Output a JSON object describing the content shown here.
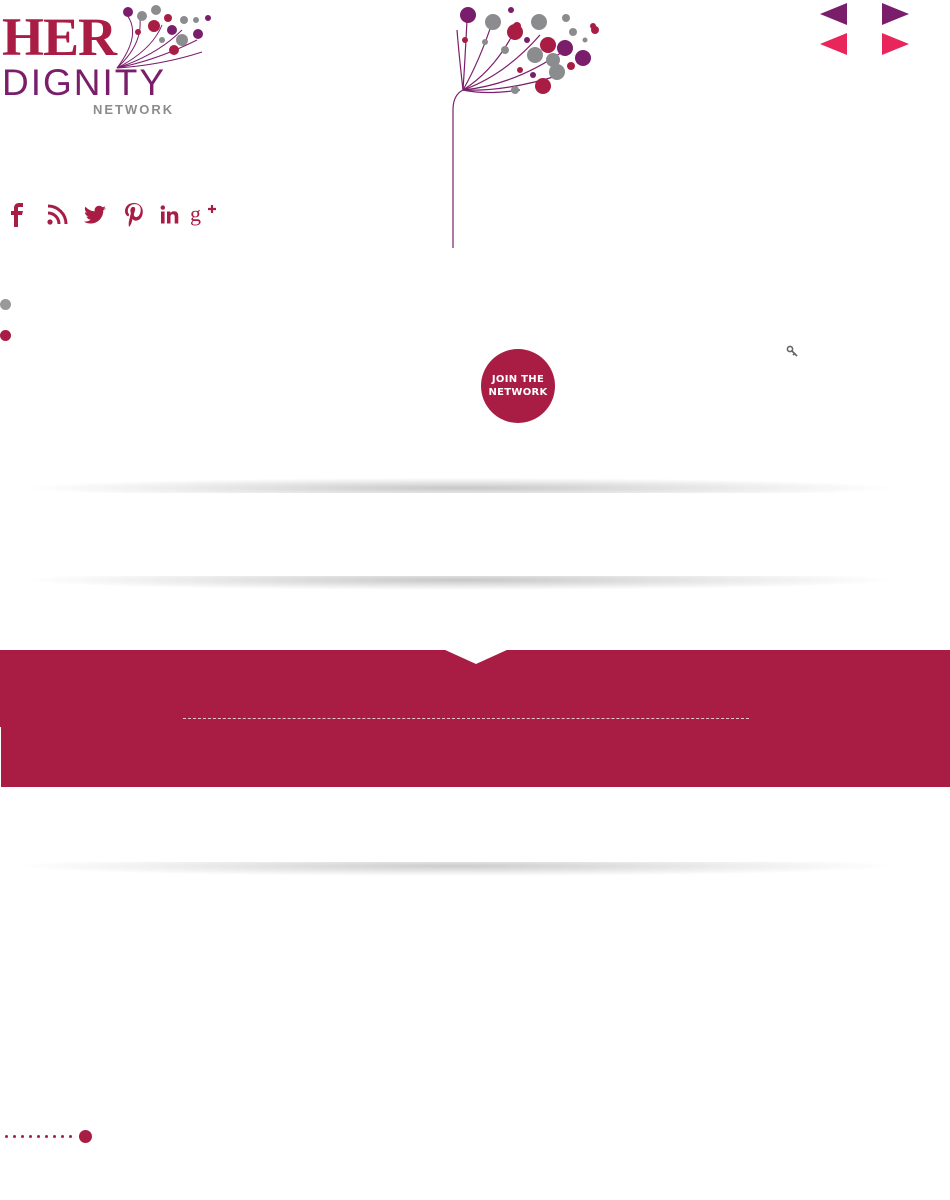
{
  "colors": {
    "brand_crimson": "#a91d44",
    "brand_purple": "#7a1e6c",
    "brand_gray": "#8b8c8e",
    "arrow_pink": "#e8265b",
    "bullet_gray": "#999999"
  },
  "logo": {
    "line1": "HER",
    "line2": "DIGNITY",
    "line3": "NETWORK"
  },
  "social": [
    {
      "name": "facebook-icon"
    },
    {
      "name": "rss-icon"
    },
    {
      "name": "twitter-icon"
    },
    {
      "name": "pinterest-icon"
    },
    {
      "name": "linkedin-icon"
    },
    {
      "name": "google-plus-icon"
    }
  ],
  "slider_arrows": [
    {
      "name": "prev-arrow-purple",
      "direction": "left"
    },
    {
      "name": "next-arrow-purple",
      "direction": "right"
    },
    {
      "name": "prev-arrow-pink",
      "direction": "left"
    },
    {
      "name": "next-arrow-pink",
      "direction": "right"
    }
  ],
  "search": {
    "icon": "search-icon"
  },
  "join_button": {
    "line1": "JOIN THE",
    "line2": "NETWORK"
  }
}
